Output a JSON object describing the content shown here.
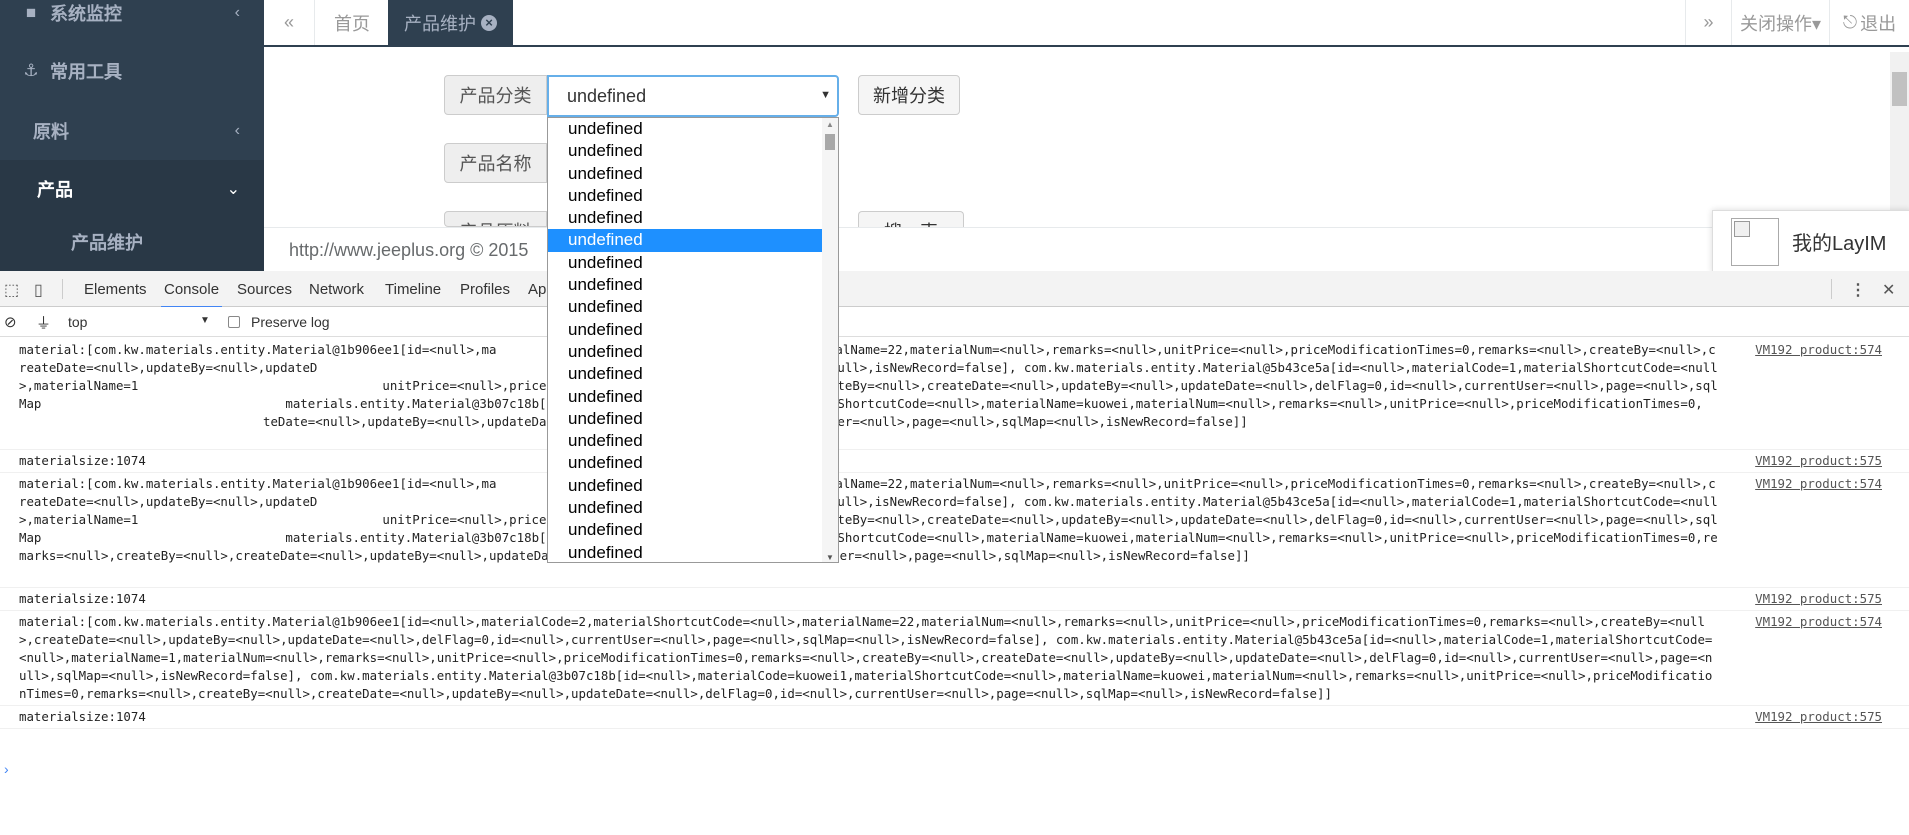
{
  "sidebar": {
    "items": [
      {
        "label": "系统监控",
        "icon": "video-camera-icon",
        "chevron": "‹"
      },
      {
        "label": "常用工具",
        "icon": "anchor-icon",
        "chevron": ""
      },
      {
        "label": "原料",
        "icon": "",
        "chevron": "‹"
      },
      {
        "label": "产品",
        "icon": "",
        "chevron": "⌄"
      }
    ],
    "sub_item": "产品维护"
  },
  "tabbar": {
    "back_icon": "«",
    "tabs": [
      {
        "label": "首页"
      },
      {
        "label": "产品维护",
        "close": "×"
      }
    ],
    "forward_icon": "»",
    "close_ops": "关闭操作▾",
    "logout": "退出",
    "logout_icon": "⎋"
  },
  "form": {
    "category_label": "产品分类",
    "category_value": "undefined",
    "add_category": "新增分类",
    "name_label": "产品名称",
    "row3_label": "产品原料",
    "row3_button": "搜一索"
  },
  "dropdown": {
    "options": [
      "undefined",
      "undefined",
      "undefined",
      "undefined",
      "undefined",
      "undefined",
      "undefined",
      "undefined",
      "undefined",
      "undefined",
      "undefined",
      "undefined",
      "undefined",
      "undefined",
      "undefined",
      "undefined",
      "undefined",
      "undefined",
      "undefined",
      "undefined"
    ],
    "selected_index": 5
  },
  "footer": {
    "text": "http://www.jeeplus.org © 2015"
  },
  "layim": {
    "label": "我的LayIM"
  },
  "devtools": {
    "tabs": [
      "Elements",
      "Console",
      "Sources",
      "Network",
      "Timeline",
      "Profiles",
      "Ap"
    ],
    "active_tab": "Console",
    "context": "top",
    "preserve_log": "Preserve log",
    "messages": [
      {
        "text": "material:[com.kw.materials.entity.Material@1b906ee1[id=<null>,ma",
        "text_mid": "<null>,materialName=22,materialNum=<null>,remarks=<null>,unitPrice=<null>,priceModificationTimes=0,remarks=<null>,createBy=<null>,createDate=<null>,updateBy=<null>,updateD",
        "text_tail": "rentUser=<null>,page=<null>,sqlMap=<null>,isNewRecord=false], com.kw.materials.entity.Material@5b43ce5a[id=<null>,materialCode=1,materialShortcutCode=<null>,materialName=1",
        "text_end": "unitPrice=<null>,priceModificationTimes=0,remarks=<null>,createBy=<null>,createDate=<null>,updateBy=<null>,updateDate=<null>,delFlag=0,id=<null>,currentUser=<null>,page=<null>,sqlMap",
        "text_last": "materials.entity.Material@3b07c18b[id=<null>,materialCode=kuowei1,materialShortcutCode=<null>,materialName=kuowei,materialNum=<null>,remarks=<null>,unitPrice=<null>,priceModificationTimes=0,",
        "text_final": "teDate=<null>,updateBy=<null>,updateDate=<null>,delFlag=0,id=<null>,currentUser=<null>,page=<null>,sqlMap=<null>,isNewRecord=false]]",
        "src": "VM192 product:574"
      },
      {
        "text": "materialsize:1074",
        "src": "VM192 product:575"
      },
      {
        "text": "material:[com.kw.materials.entity.Material@1b906ee1[id=<null>,ma",
        "text_mid": "<null>,materialName=22,materialNum=<null>,remarks=<null>,unitPrice=<null>,priceModificationTimes=0,remarks=<null>,createBy=<null>,createDate=<null>,updateBy=<null>,updateD",
        "text_tail": "rentUser=<null>,page=<null>,sqlMap=<null>,isNewRecord=false], com.kw.materials.entity.Material@5b43ce5a[id=<null>,materialCode=1,materialShortcutCode=<null>,materialName=1",
        "text_end": "unitPrice=<null>,priceModificationTimes=0,remarks=<null>,createBy=<null>,createDate=<null>,updateBy=<null>,updateDate=<null>,delFlag=0,id=<null>,currentUser=<null>,page=<null>,sqlMap",
        "text_last": "materials.entity.Material@3b07c18b[id=<null>,materialCode=kuowei1,materialShortcutCode=<null>,materialName=kuowei,materialNum=<null>,remarks=<null>,unitPrice=<null>,priceModificationTimes=0,remarks=<null>,createBy=<null>,createDate=<null>,updateBy=<null>,updateDate=<null>,delFlag=0,id=<null>,currentUser=<null>,page=<null>,sqlMap=<null>,isNewRecord=false]]",
        "text_final": "",
        "src": "VM192 product:574"
      },
      {
        "text": "materialsize:1074",
        "src": "VM192 product:575"
      },
      {
        "text": "material:[com.kw.materials.entity.Material@1b906ee1[id=<null>,materialCode=2,materialShortcutCode=<null>,materialName=22,materialNum=<null>,remarks=<null>,unitPrice=<null>,priceModificationTimes=0,remarks=<null>,createBy=<null>,createDate=<null>,updateBy=<null>,updateDate=<null>,delFlag=0,id=<null>,currentUser=<null>,page=<null>,sqlMap=<null>,isNewRecord=false], com.kw.materials.entity.Material@5b43ce5a[id=<null>,materialCode=1,materialShortcutCode=<null>,materialName=1,materialNum=<null>,remarks=<null>,unitPrice=<null>,priceModificationTimes=0,remarks=<null>,createBy=<null>,createDate=<null>,updateBy=<null>,updateDate=<null>,delFlag=0,id=<null>,currentUser=<null>,page=<null>,sqlMap=<null>,isNewRecord=false], com.kw.materials.entity.Material@3b07c18b[id=<null>,materialCode=kuowei1,materialShortcutCode=<null>,materialName=kuowei,materialNum=<null>,remarks=<null>,unitPrice=<null>,priceModificationTimes=0,remarks=<null>,createBy=<null>,createDate=<null>,updateBy=<null>,updateDate=<null>,delFlag=0,id=<null>,currentUser=<null>,page=<null>,sqlMap=<null>,isNewRecord=false]]",
        "src": "VM192 product:574"
      },
      {
        "text": "materialsize:1074",
        "src": "VM192 product:575"
      }
    ],
    "prompt": "›"
  }
}
